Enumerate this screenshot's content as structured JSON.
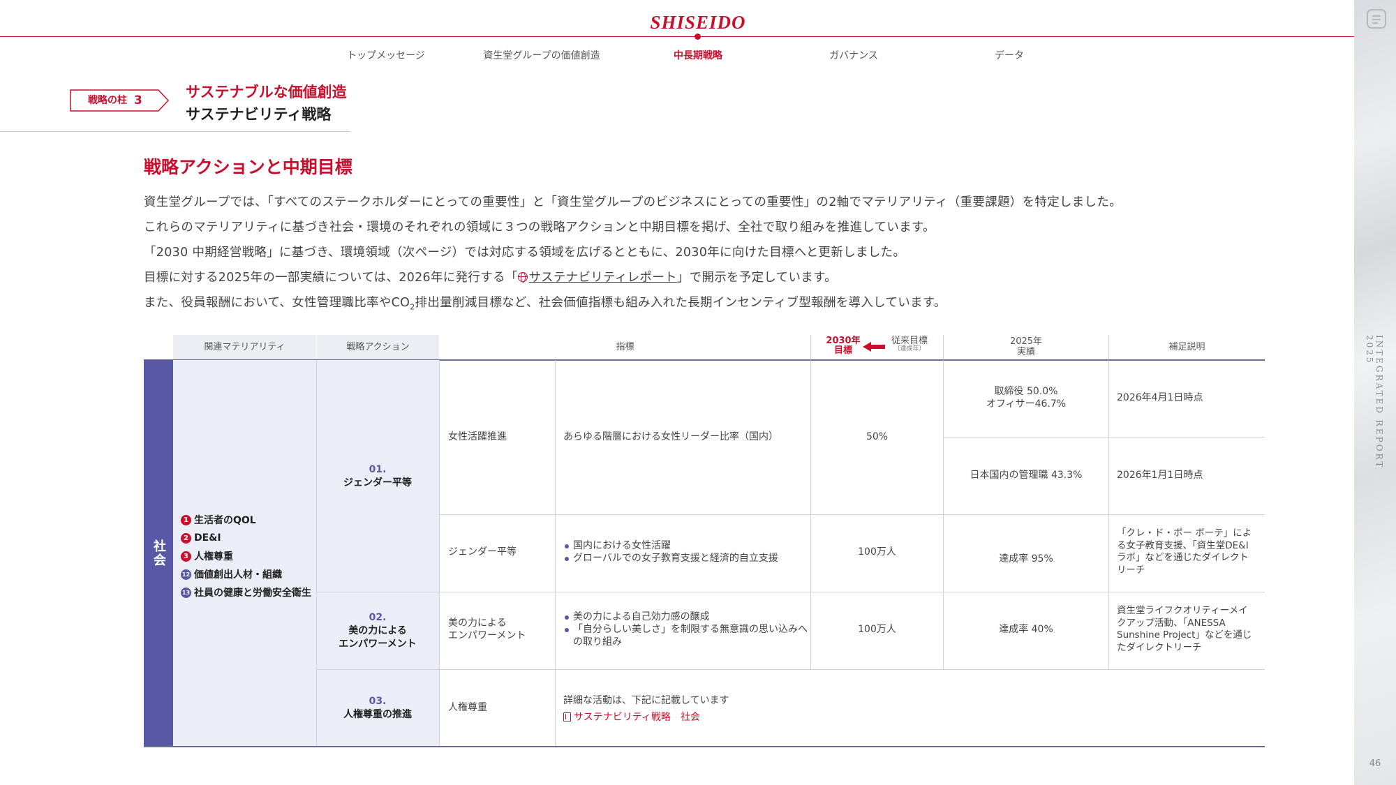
{
  "header": {
    "logo_text": "SHISEIDO",
    "nav": [
      "トップメッセージ",
      "資生堂グループの価値創造",
      "中長期戦略",
      "ガバナンス",
      "データ"
    ],
    "active_nav": "中長期戦略"
  },
  "side": {
    "vertical_text": "INTEGRATED REPORT 2025",
    "page_number": "46"
  },
  "heading": {
    "pillar_label": "戦略の柱",
    "pillar_number": "3",
    "subtitle": "サステナブルな価値創造",
    "title": "サステナビリティ戦略"
  },
  "section": {
    "title": "戦略アクションと中期目標",
    "para1": "資生堂グループでは、「すべてのステークホルダーにとっての重要性」と「資生堂グループのビジネスにとっての重要性」の2軸でマテリアリティ（重要課題）を特定しました。",
    "para2": "これらのマテリアリティに基づき社会・環境のそれぞれの領域に３つの戦略アクションと中期目標を掲げ、全社で取り組みを推進しています。",
    "para3": "「2030 中期経営戦略」に基づき、環境領域（次ページ）では対応する領域を広げるとともに、2030年に向けた目標へと更新しました。",
    "para4_pre": "目標に対する2025年の一部実績については、2026年に発行する「",
    "para4_link": "サステナビリティレポート",
    "para4_post": "」で開示を予定しています。",
    "para5_pre": "また、役員報酬において、女性管理職比率やCO",
    "para5_sub": "2",
    "para5_post": "排出量削減目標など、社会価値指標も組み入れた長期インセンティブ型報酬を導入しています。"
  },
  "table": {
    "headers": {
      "materiality": "関連マテリアリティ",
      "action": "戦略アクション",
      "indicator": "指標",
      "target_2030_line1": "2030年",
      "target_2030_line2": "目標",
      "prev_target": "従来目標",
      "prev_target_note": "（達成年）",
      "result_2025_line1": "2025年",
      "result_2025_line2": "実績",
      "notes": "補足説明"
    },
    "category": "社会",
    "materialities": [
      {
        "num": "1",
        "label": "生活者のQOL",
        "color": "#c8102e"
      },
      {
        "num": "2",
        "label": "DE&I",
        "color": "#c8102e"
      },
      {
        "num": "3",
        "label": "人権尊重",
        "color": "#c8102e"
      },
      {
        "num": "12",
        "label": "価値創出人材・組織",
        "color": "#5858a6"
      },
      {
        "num": "13",
        "label": "社員の健康と労働安全衛生",
        "color": "#5858a6"
      }
    ],
    "actions": [
      {
        "num": "01.",
        "label": "ジェンダー平等"
      },
      {
        "num": "02.",
        "label_line1": "美の力による",
        "label_line2": "エンパワーメント"
      },
      {
        "num": "03.",
        "label": "人権尊重の推進"
      }
    ],
    "rows": [
      {
        "sub": "女性活躍推進",
        "indicator": "あらゆる階層における女性リーダー比率（国内）",
        "target": "50%",
        "result_a_line1": "取締役 50.0%",
        "result_a_line2": "オフィサー46.7%",
        "note_a": "2026年4月1日時点",
        "result_b": "日本国内の管理職 43.3%",
        "note_b": "2026年1月1日時点"
      },
      {
        "sub": "ジェンダー平等",
        "bullets": [
          "国内における女性活躍",
          "グローバルでの女子教育支援と経済的自立支援"
        ],
        "target": "100万人",
        "result": "達成率 95%",
        "note": "「クレ・ド・ポー ボーテ」による女子教育支援、「資生堂DE&Iラボ」などを通じたダイレクトリーチ"
      },
      {
        "sub_line1": "美の力による",
        "sub_line2": "エンパワーメント",
        "bullets": [
          "美の力による自己効力感の醸成",
          "「自分らしい美しさ」を制限する無意識の思い込みへの取り組み"
        ],
        "target": "100万人",
        "result": "達成率 40%",
        "note": "資生堂ライフクオリティーメイクアップ活動、「ANESSA Sunshine Project」などを通じたダイレクトリーチ"
      },
      {
        "sub": "人権尊重",
        "detail": "詳細な活動は、下記に記載しています",
        "link": "サステナビリティ戦略　社会"
      }
    ]
  }
}
